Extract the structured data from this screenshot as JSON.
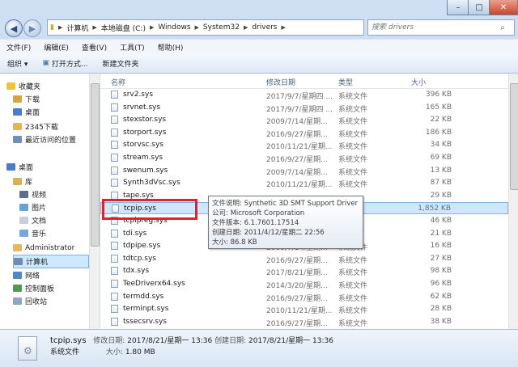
{
  "addressbar": {
    "path": [
      "计算机",
      "本地磁盘 (C:)",
      "Windows",
      "System32",
      "drivers"
    ],
    "search_placeholder": "搜索 drivers"
  },
  "menu": [
    "文件(F)",
    "编辑(E)",
    "查看(V)",
    "工具(T)",
    "帮助(H)"
  ],
  "toolbar": {
    "organize": "组织 ▾",
    "open_with": "打开方式...",
    "new_folder": "新建文件夹"
  },
  "nav": [
    {
      "label": "收藏夹",
      "icon": "star-icon",
      "color": "#f0c23a",
      "indent": 0
    },
    {
      "label": "下载",
      "icon": "download-folder-icon",
      "color": "#d7a640",
      "indent": 1
    },
    {
      "label": "桌面",
      "icon": "desktop-icon",
      "color": "#4a7cc7",
      "indent": 1
    },
    {
      "label": "2345下载",
      "icon": "folder-icon",
      "color": "#e3b94e",
      "indent": 1
    },
    {
      "label": "最近访问的位置",
      "icon": "recent-places-icon",
      "color": "#6f8fb5",
      "indent": 1
    },
    {
      "label": "桌面",
      "icon": "desktop-icon",
      "color": "#4a7cc7",
      "indent": 0
    },
    {
      "label": "库",
      "icon": "library-icon",
      "color": "#d8b258",
      "indent": 1
    },
    {
      "label": "视频",
      "icon": "video-icon",
      "color": "#5b6f8c",
      "indent": 2
    },
    {
      "label": "图片",
      "icon": "pictures-icon",
      "color": "#6aa2d6",
      "indent": 2
    },
    {
      "label": "文档",
      "icon": "documents-icon",
      "color": "#c9cfd8",
      "indent": 2
    },
    {
      "label": "音乐",
      "icon": "music-icon",
      "color": "#7aa6d8",
      "indent": 2
    },
    {
      "label": "Administrator",
      "icon": "user-icon",
      "color": "#e5b960",
      "indent": 1
    },
    {
      "label": "计算机",
      "icon": "computer-icon",
      "color": "#6b8db5",
      "indent": 1,
      "selected": true
    },
    {
      "label": "网络",
      "icon": "network-icon",
      "color": "#4f87c8",
      "indent": 1
    },
    {
      "label": "控制面板",
      "icon": "control-panel-icon",
      "color": "#4d9b53",
      "indent": 1
    },
    {
      "label": "回收站",
      "icon": "recycle-bin-icon",
      "color": "#8da6c2",
      "indent": 1
    }
  ],
  "columns": {
    "name": "名称",
    "date": "修改日期",
    "type": "类型",
    "size": "大小"
  },
  "files": [
    {
      "name": "srv2.sys",
      "date": "2017/9/7/星期四 ...",
      "type": "系统文件",
      "size": "396 KB"
    },
    {
      "name": "srvnet.sys",
      "date": "2017/9/7/星期四 ...",
      "type": "系统文件",
      "size": "165 KB"
    },
    {
      "name": "stexstor.sys",
      "date": "2009/7/14/星期...",
      "type": "系统文件",
      "size": "22 KB"
    },
    {
      "name": "storport.sys",
      "date": "2016/9/27/星期...",
      "type": "系统文件",
      "size": "186 KB"
    },
    {
      "name": "storvsc.sys",
      "date": "2010/11/21/星期...",
      "type": "系统文件",
      "size": "34 KB"
    },
    {
      "name": "stream.sys",
      "date": "2016/9/27/星期...",
      "type": "系统文件",
      "size": "69 KB"
    },
    {
      "name": "swenum.sys",
      "date": "2009/7/14/星期...",
      "type": "系统文件",
      "size": "13 KB"
    },
    {
      "name": "Synth3dVsc.sys",
      "date": "2010/11/21/星期...",
      "type": "系统文件",
      "size": "87 KB"
    },
    {
      "name": "tape.sys",
      "date": "",
      "type": "",
      "size": "29 KB"
    },
    {
      "name": "tcpip.sys",
      "date": "",
      "type": "",
      "size": "1,852 KB",
      "selected": true
    },
    {
      "name": "tcpipreg.sys",
      "date": "",
      "type": "",
      "size": "46 KB"
    },
    {
      "name": "tdi.sys",
      "date": "",
      "type": "",
      "size": "21 KB"
    },
    {
      "name": "tdpipe.sys",
      "date": "2009/7/14/星期...",
      "type": "系统文件",
      "size": "16 KB"
    },
    {
      "name": "tdtcp.sys",
      "date": "2016/9/27/星期...",
      "type": "系统文件",
      "size": "27 KB"
    },
    {
      "name": "tdx.sys",
      "date": "2017/8/21/星期...",
      "type": "系统文件",
      "size": "98 KB"
    },
    {
      "name": "TeeDriverx64.sys",
      "date": "2014/3/20/星期...",
      "type": "系统文件",
      "size": "96 KB"
    },
    {
      "name": "termdd.sys",
      "date": "2016/9/27/星期...",
      "type": "系统文件",
      "size": "62 KB"
    },
    {
      "name": "terminpt.sys",
      "date": "2010/11/21/星期...",
      "type": "系统文件",
      "size": "28 KB"
    },
    {
      "name": "tssecsrv.sys",
      "date": "2016/9/27/星期...",
      "type": "系统文件",
      "size": "38 KB"
    }
  ],
  "tooltip": [
    "文件说明: Synthetic 3D SMT Support Driver",
    "公司: Microsoft Corporation",
    "文件版本: 6.1.7601.17514",
    "创建日期: 2011/4/12/星期二 22:56",
    "大小: 86.8 KB"
  ],
  "status": {
    "filename": "tcpip.sys",
    "modified_label": "修改日期:",
    "modified": "2017/8/21/星期一 13:36",
    "created_label": "创建日期:",
    "created": "2017/8/21/星期一 13:36",
    "type": "系统文件",
    "size_label": "大小:",
    "size": "1.80 MB"
  }
}
